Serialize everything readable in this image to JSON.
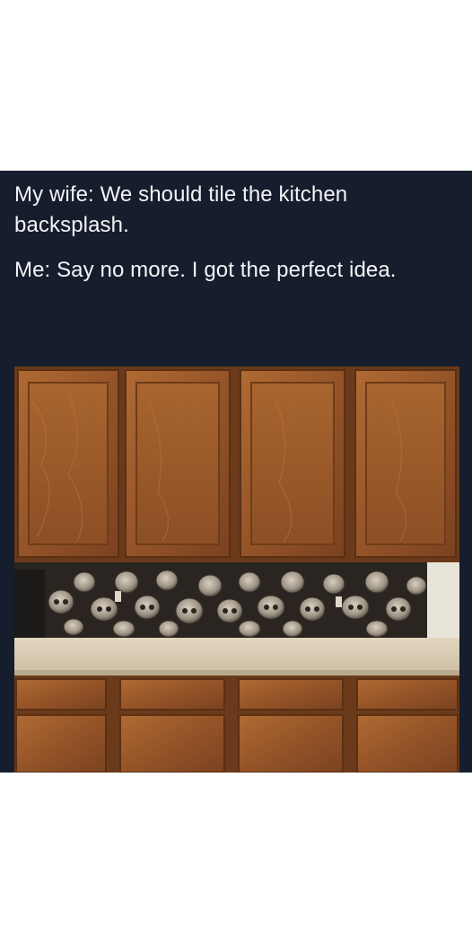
{
  "post": {
    "line1": "My wife: We should tile the kitchen backsplash.",
    "line2": "Me: Say no more. I got the perfect idea."
  },
  "photo": {
    "subject": "kitchen-backsplash-skulls",
    "colors": {
      "background": "#161d2c",
      "cabinet_wood": "#9a5a2c",
      "countertop": "#d9ccb4",
      "skulls": "#b7aea0"
    }
  }
}
